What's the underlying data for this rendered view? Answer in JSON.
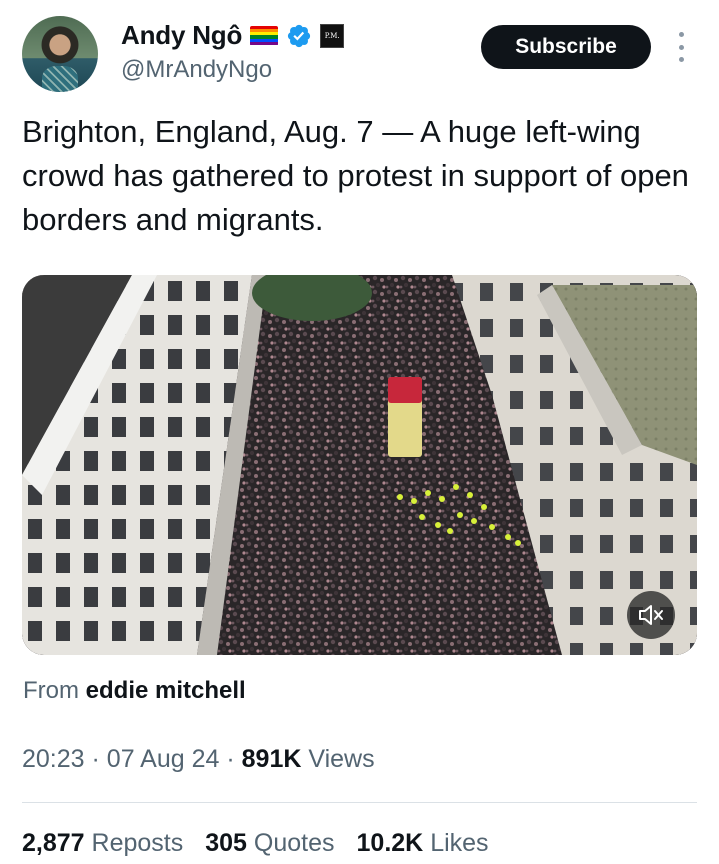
{
  "author": {
    "display_name": "Andy Ngô",
    "handle": "@MrAndyNgo",
    "affiliation_badge": "P.M.",
    "verified_color": "#1d9bf0",
    "flag_colors": [
      "#e40303",
      "#ff8c00",
      "#ffed00",
      "#008026",
      "#004dff",
      "#750787"
    ]
  },
  "actions": {
    "subscribe_label": "Subscribe"
  },
  "tweet": {
    "text": "Brighton, England, Aug. 7 — A huge left-wing crowd has gathered to protest in support of open borders and migrants."
  },
  "media": {
    "type": "video",
    "muted": true
  },
  "attribution": {
    "prefix": "From",
    "source": "eddie mitchell"
  },
  "meta": {
    "time": "20:23",
    "date": "07 Aug 24",
    "views_count": "891K",
    "views_label": "Views"
  },
  "stats": {
    "reposts_count": "2,877",
    "reposts_label": "Reposts",
    "quotes_count": "305",
    "quotes_label": "Quotes",
    "likes_count": "10.2K",
    "likes_label": "Likes"
  }
}
